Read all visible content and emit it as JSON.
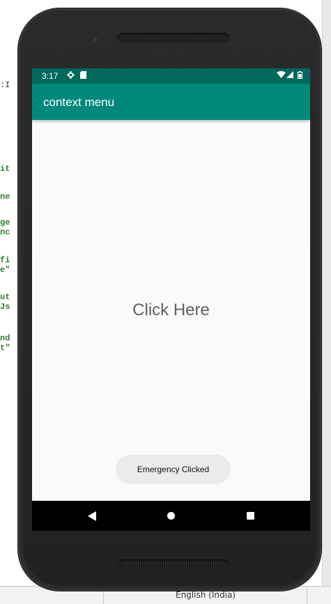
{
  "ide": {
    "code_fragments": [
      ":I",
      "it",
      "ne",
      "ge",
      "nc",
      "fi",
      "e\"",
      "ut",
      "Js",
      "nd",
      "t\""
    ],
    "status_language": "English (India)"
  },
  "device": {
    "status_bar": {
      "time": "3:17",
      "icons": [
        "gear-icon",
        "sd-card-icon",
        "wifi-icon",
        "signal-icon",
        "battery-icon"
      ]
    },
    "app_bar": {
      "title": "context menu"
    },
    "content": {
      "center_label": "Click Here"
    },
    "toast": {
      "message": "Emergency Clicked"
    },
    "nav_bar": {
      "buttons": [
        "back",
        "home",
        "recents"
      ]
    }
  },
  "colors": {
    "status_bar": "#00695c",
    "app_bar": "#00897b",
    "screen_bg": "#fafafa",
    "toast_bg": "#ebebeb"
  }
}
